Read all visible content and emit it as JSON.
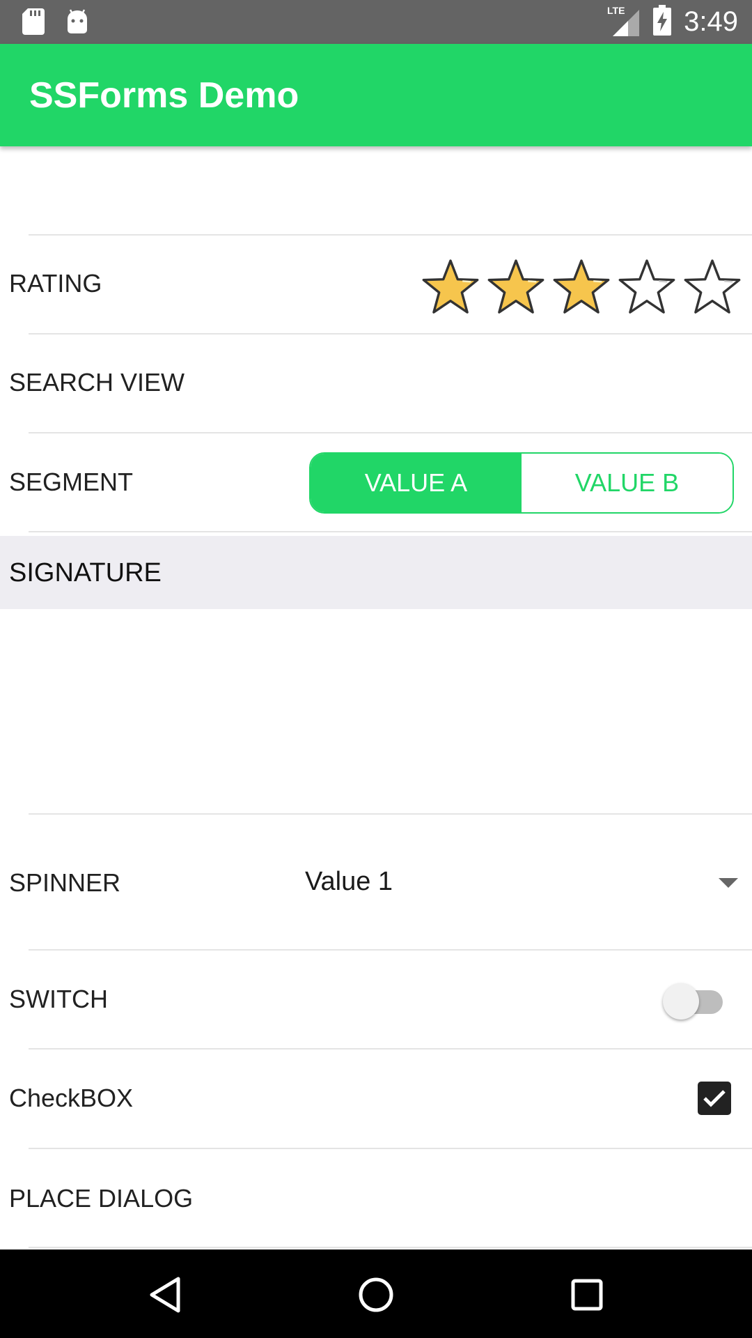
{
  "status_bar": {
    "time": "3:49",
    "network": "LTE",
    "icons": [
      "sd-card-icon",
      "android-icon",
      "signal-icon",
      "battery-charging-icon"
    ]
  },
  "app_bar": {
    "title": "SSForms Demo",
    "color": "#21d667"
  },
  "form": {
    "rating": {
      "label": "RATING",
      "value": 3,
      "max": 5
    },
    "search_view": {
      "label": "SEARCH VIEW"
    },
    "segment": {
      "label": "SEGMENT",
      "options": [
        "VALUE A",
        "VALUE B"
      ],
      "selected": "VALUE A"
    },
    "signature": {
      "label": "SIGNATURE"
    },
    "spinner": {
      "label": "SPINNER",
      "value": "Value 1"
    },
    "switch": {
      "label": "SWITCH",
      "checked": false
    },
    "checkbox": {
      "label": "CheckBOX",
      "checked": true
    },
    "place_dialog": {
      "label": "PLACE DIALOG"
    }
  },
  "nav_bar": {
    "icons": [
      "back-icon",
      "home-icon",
      "recents-icon"
    ]
  }
}
